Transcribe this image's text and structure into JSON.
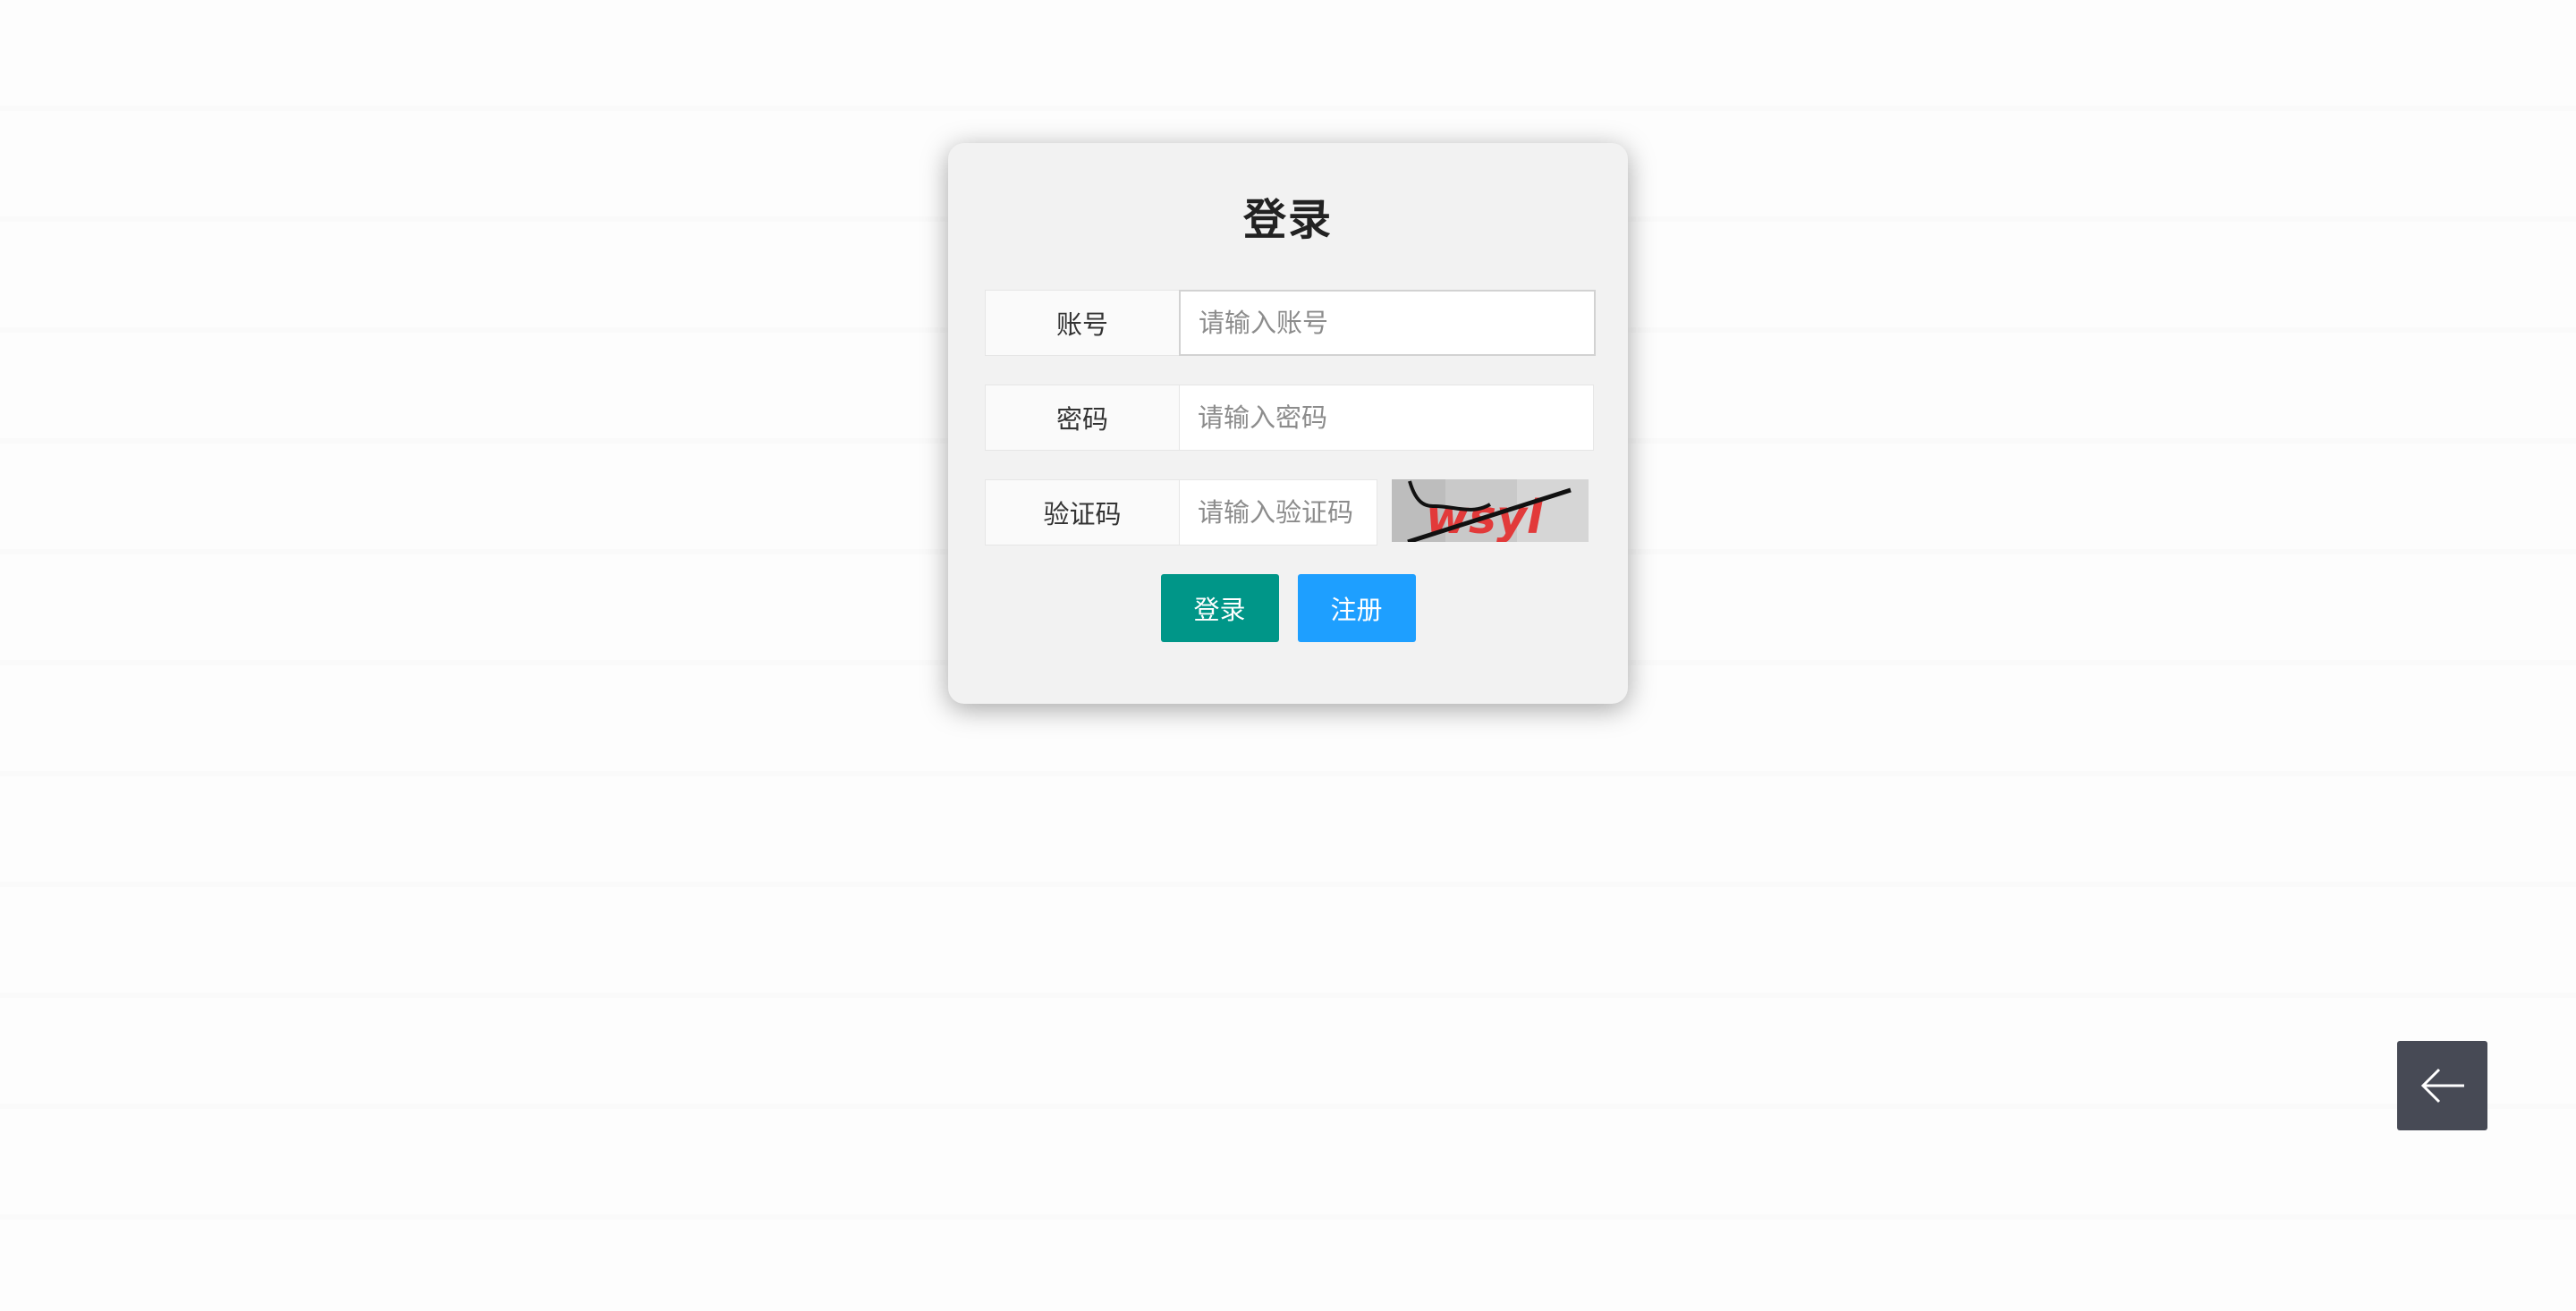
{
  "login_form": {
    "title": "登录",
    "account": {
      "label": "账号",
      "placeholder": "请输入账号",
      "value": ""
    },
    "password": {
      "label": "密码",
      "placeholder": "请输入密码",
      "value": ""
    },
    "captcha": {
      "label": "验证码",
      "placeholder": "请输入验证码",
      "value": "",
      "image_text": "wsyl"
    },
    "login_button": "登录",
    "register_button": "注册"
  },
  "back_button": {
    "icon": "arrow-left-icon"
  },
  "colors": {
    "login_button": "#009688",
    "register_button": "#1e9fff",
    "back_button": "#474a55",
    "card_background": "#f2f2f2"
  }
}
